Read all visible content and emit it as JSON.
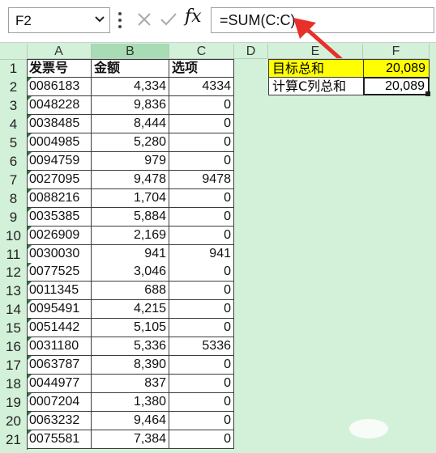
{
  "formula_bar": {
    "name_box": "F2",
    "fx_label": "fx",
    "formula": "=SUM(C:C)"
  },
  "columns": [
    "A",
    "B",
    "C",
    "D",
    "E",
    "F"
  ],
  "selected_column": "B",
  "row_numbers": [
    "1",
    "2",
    "3",
    "4",
    "5",
    "6",
    "7",
    "8",
    "9",
    "10",
    "11",
    "12",
    "13",
    "14",
    "15",
    "16",
    "17",
    "18",
    "19",
    "20",
    "21"
  ],
  "table": {
    "headers": [
      "发票号",
      "金额",
      "选项"
    ],
    "rows": [
      [
        "0086183",
        "4,334",
        "4334"
      ],
      [
        "0048228",
        "9,836",
        "0"
      ],
      [
        "0038485",
        "8,444",
        "0"
      ],
      [
        "0004985",
        "5,280",
        "0"
      ],
      [
        "0094759",
        "979",
        "0"
      ],
      [
        "0027095",
        "9,478",
        "9478"
      ],
      [
        "0088216",
        "1,704",
        "0"
      ],
      [
        "0035385",
        "5,884",
        "0"
      ],
      [
        "0026909",
        "2,169",
        "0"
      ],
      [
        "0030030",
        "941",
        "941"
      ],
      [
        "0077525",
        "3,046",
        "0"
      ],
      [
        "0011345",
        "688",
        "0"
      ],
      [
        "0095491",
        "4,215",
        "0"
      ],
      [
        "0051442",
        "5,105",
        "0"
      ],
      [
        "0031180",
        "5,336",
        "5336"
      ],
      [
        "0063787",
        "8,390",
        "0"
      ],
      [
        "0044977",
        "837",
        "0"
      ],
      [
        "0007204",
        "1,380",
        "0"
      ],
      [
        "0063232",
        "9,464",
        "0"
      ],
      [
        "0075581",
        "7,384",
        "0"
      ]
    ]
  },
  "summary": {
    "target_label": "目标总和",
    "target_value": "20,089",
    "calc_label": "计算C列总和",
    "calc_value": "20,089"
  },
  "colors": {
    "sheet_bg": "#d3f1d9",
    "highlight_yellow": "#ffff00",
    "arrow_red": "#e8302a"
  }
}
